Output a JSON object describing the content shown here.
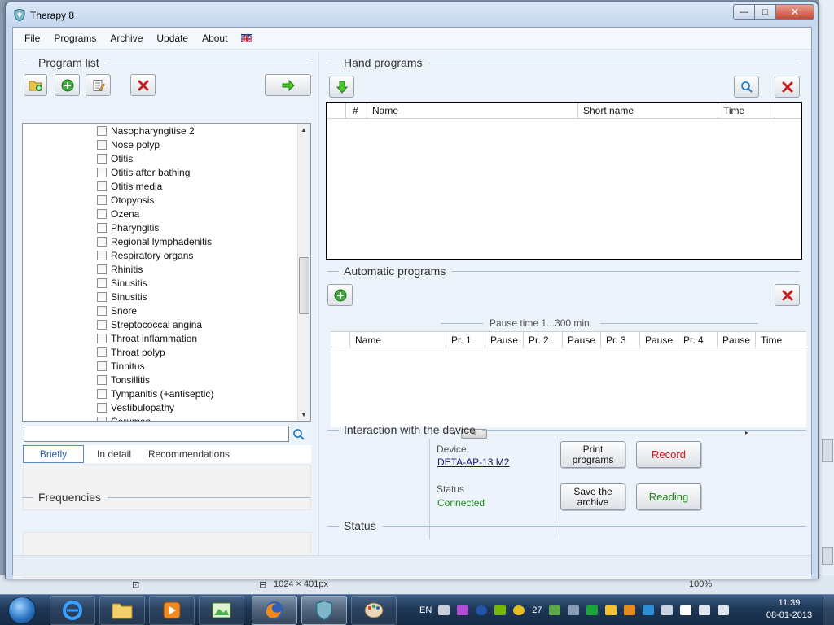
{
  "window": {
    "title": "Therapy 8",
    "min_label": "—",
    "max_label": "□",
    "close_label": "✕"
  },
  "menu": {
    "items": [
      "File",
      "Programs",
      "Archive",
      "Update",
      "About"
    ]
  },
  "program_list": {
    "heading": "Program list",
    "items": [
      "Nasopharyngitise 2",
      "Nose polyp",
      "Otitis",
      "Otitis after bathing",
      "Otitis media",
      "Otopyosis",
      "Ozena",
      "Pharyngitis",
      "Regional lymphadenitis",
      "Respiratory organs",
      "Rhinitis",
      "Sinusitis",
      "Sinusitis",
      "Snore",
      "Streptococcal angina",
      "Throat inflammation",
      "Throat polyp",
      "Tinnitus",
      "Tonsillitis",
      "Tympanitis (+antiseptic)",
      "Vestibulopathy",
      "Cerumen"
    ],
    "search_value": "",
    "tabs": [
      "Briefly",
      "In detail",
      "Recommendations"
    ],
    "active_tab": "Briefly"
  },
  "frequencies": {
    "heading": "Frequencies"
  },
  "hand_programs": {
    "heading": "Hand programs",
    "columns": [
      "#",
      "Name",
      "Short name",
      "Time"
    ]
  },
  "automatic_programs": {
    "heading": "Automatic programs",
    "pause_label": "Pause time 1...300 min.",
    "columns": [
      "Name",
      "Pr. 1",
      "Pause",
      "Pr. 2",
      "Pause",
      "Pr. 3",
      "Pause",
      "Pr. 4",
      "Pause",
      "Time"
    ],
    "scroll_thumb": "III"
  },
  "device": {
    "heading": "Interaction with the device",
    "device_label": "Device",
    "device_name": "DETA-AP-13 M2",
    "status_label": "Status",
    "status_value": "Connected",
    "buttons": {
      "print": "Print programs",
      "record": "Record",
      "save": "Save the archive",
      "reading": "Reading"
    },
    "colors": {
      "record": "#d01818",
      "reading": "#1f8a1f",
      "connected": "#1f8a1f"
    }
  },
  "status": {
    "heading": "Status",
    "progress": 0
  },
  "background_app": {
    "dimensions": "1024 × 401px",
    "zoom": "100%"
  },
  "taskbar": {
    "lang": "EN",
    "tray_count": "27",
    "time": "11:39",
    "date": "08-01-2013"
  }
}
